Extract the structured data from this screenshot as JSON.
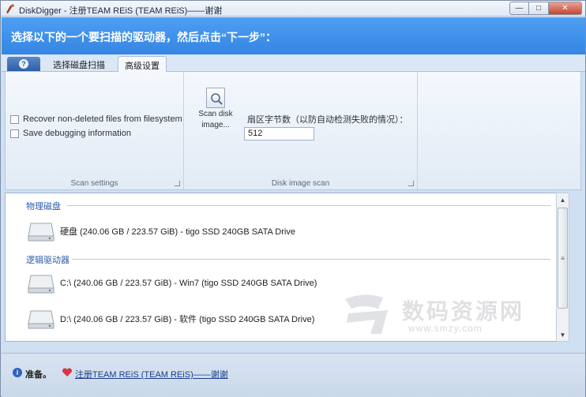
{
  "window": {
    "title": "DiskDigger - 注册TEAM REiS (TEAM REiS)——谢谢",
    "minimize_glyph": "—",
    "maximize_glyph": "□",
    "close_glyph": "✕"
  },
  "banner": {
    "instruction": "选择以下的一个要扫描的驱动器，然后点击“下一步”："
  },
  "tabs": {
    "help_glyph": "?",
    "items": [
      {
        "label": "选择磁盘扫描"
      },
      {
        "label": "高级设置"
      }
    ],
    "active_index": 1
  },
  "ribbon": {
    "scan_settings": {
      "group_label": "Scan settings",
      "options": [
        {
          "label": "Recover non-deleted files from filesystem",
          "checked": false
        },
        {
          "label": "Save debugging information",
          "checked": false
        }
      ]
    },
    "disk_image_scan": {
      "group_label": "Disk image scan",
      "scan_button_label_line1": "Scan disk",
      "scan_button_label_line2": "image...",
      "sector_label": "扇区字节数（以防自动检测失败的情况）：",
      "sector_value": "512"
    }
  },
  "drives": {
    "physical_header": "物理磁盘",
    "physical": [
      {
        "label": "硬盘 (240.06 GB / 223.57 GiB) - tigo SSD 240GB SATA Drive"
      }
    ],
    "logical_header": "逻辑驱动器",
    "logical": [
      {
        "label": "C:\\ (240.06 GB / 223.57 GiB) - Win7 (tigo SSD 240GB SATA Drive)"
      },
      {
        "label": "D:\\ (240.06 GB / 223.57 GiB) - 软件 (tigo SSD 240GB SATA Drive)"
      }
    ]
  },
  "scrollbar": {
    "up_glyph": "▲",
    "down_glyph": "▼",
    "grip_glyph": "≡"
  },
  "watermark": {
    "text": "数码资源网",
    "url": "www.smzy.com"
  },
  "statusbar": {
    "info_glyph": "i",
    "status": "准备。",
    "register_link": "注册TEAM REiS (TEAM REiS)——谢谢"
  },
  "colors": {
    "banner": "#3d8fea",
    "window_bg": "#cfe0f3",
    "category_text": "#2a5ca8",
    "link": "#1a3d8f"
  }
}
